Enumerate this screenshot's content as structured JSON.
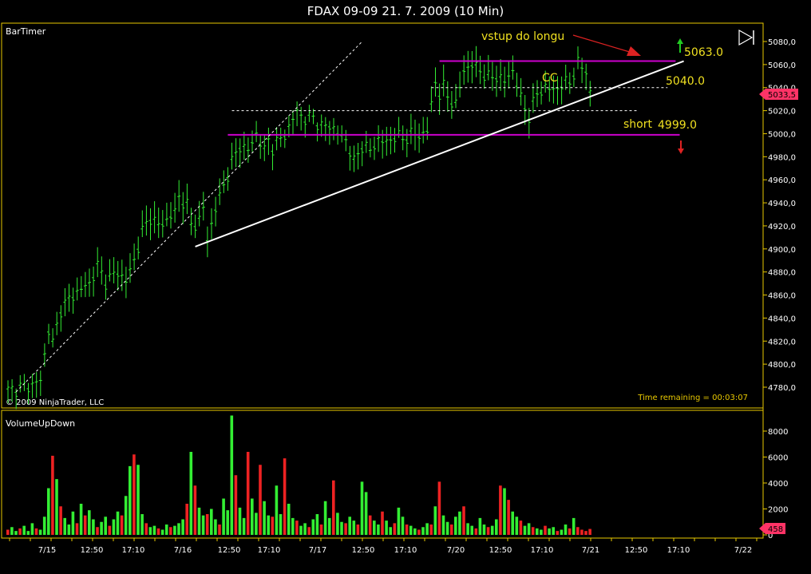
{
  "window": {
    "title": "FDAX 09-09  21. 7. 2009 (10 Min)"
  },
  "price_panel": {
    "indicator_label": "BarTimer",
    "copyright": "© 2009 NinjaTrader, LLC",
    "time_remaining": "Time remaining = 00:03:07",
    "current_price_badge": "5033,5",
    "y_ticks": [
      "5080,0",
      "5060,0",
      "5040,0",
      "5020,0",
      "5000,0",
      "4980,0",
      "4960,0",
      "4940,0",
      "4920,0",
      "4900,0",
      "4880,0",
      "4860,0",
      "4840,0",
      "4820,0",
      "4800,0",
      "4780,0"
    ],
    "annotations": {
      "entry_text": "vstup do longu",
      "cc_text": "CC",
      "short_text": "short",
      "level_high": "5063.0",
      "level_mid": "5040.0",
      "level_low": "4999.0"
    }
  },
  "volume_panel": {
    "label": "VolumeUpDown",
    "y_ticks": [
      "8000",
      "6000",
      "4000",
      "2000",
      "0"
    ],
    "current_volume_badge": "458"
  },
  "x_ticks": [
    "7/15",
    "12:50",
    "17:10",
    "7/16",
    "12:50",
    "17:10",
    "7/17",
    "12:50",
    "17:10",
    "7/20",
    "12:50",
    "17:10",
    "7/21",
    "12:50",
    "17:10",
    "7/22"
  ],
  "colors": {
    "background": "#000000",
    "grid": "#e8c800",
    "price_bars": "#33ee33",
    "volume_up": "#33ee33",
    "volume_down": "#ee2222",
    "resistance_lines": "#cc00cc",
    "trend_lines": "#ffffff",
    "annotation_text": "#f0e020",
    "arrow_up": "#22cc22",
    "arrow_down": "#dd2222",
    "badge": "#ff3366"
  },
  "chart_data": {
    "type": "ohlc",
    "instrument": "FDAX 09-09",
    "interval": "10 Min",
    "price_range": [
      4770,
      5090
    ],
    "volume_range": [
      0,
      9400
    ],
    "price_path": [
      [
        0,
        4777
      ],
      [
        3,
        4780
      ],
      [
        6,
        4782
      ],
      [
        8,
        4786
      ],
      [
        10,
        4830
      ],
      [
        11,
        4818
      ],
      [
        13,
        4848
      ],
      [
        16,
        4860
      ],
      [
        20,
        4870
      ],
      [
        22,
        4885
      ],
      [
        24,
        4872
      ],
      [
        27,
        4880
      ],
      [
        29,
        4872
      ],
      [
        31,
        4890
      ],
      [
        33,
        4915
      ],
      [
        35,
        4928
      ],
      [
        37,
        4920
      ],
      [
        39,
        4925
      ],
      [
        41,
        4932
      ],
      [
        42,
        4945
      ],
      [
        44,
        4938
      ],
      [
        45,
        4920
      ],
      [
        47,
        4925
      ],
      [
        48,
        4935
      ],
      [
        49,
        4908
      ],
      [
        51,
        4935
      ],
      [
        53,
        4955
      ],
      [
        55,
        4975
      ],
      [
        57,
        4990
      ],
      [
        59,
        4985
      ],
      [
        61,
        5000
      ],
      [
        63,
        4985
      ],
      [
        64,
        4995
      ],
      [
        65,
        4988
      ],
      [
        67,
        4995
      ],
      [
        69,
        5005
      ],
      [
        71,
        5020
      ],
      [
        73,
        5012
      ],
      [
        75,
        5015
      ],
      [
        77,
        5005
      ],
      [
        79,
        5008
      ],
      [
        81,
        5000
      ],
      [
        83,
        4995
      ],
      [
        85,
        4975
      ],
      [
        87,
        4990
      ],
      [
        89,
        4985
      ],
      [
        91,
        4995
      ],
      [
        93,
        4992
      ],
      [
        95,
        4998
      ],
      [
        97,
        4995
      ],
      [
        99,
        5000
      ],
      [
        101,
        4998
      ],
      [
        103,
        5003
      ],
      [
        105,
        5045
      ],
      [
        106,
        5035
      ],
      [
        107,
        5040
      ],
      [
        108,
        5032
      ],
      [
        110,
        5025
      ],
      [
        112,
        5055
      ],
      [
        114,
        5060
      ],
      [
        116,
        5055
      ],
      [
        118,
        5048
      ],
      [
        120,
        5050
      ],
      [
        122,
        5045
      ],
      [
        124,
        5055
      ],
      [
        126,
        5030
      ],
      [
        128,
        5015
      ],
      [
        130,
        5035
      ],
      [
        132,
        5040
      ],
      [
        134,
        5038
      ],
      [
        136,
        5042
      ],
      [
        138,
        5045
      ],
      [
        140,
        5060
      ],
      [
        142,
        5055
      ],
      [
        143,
        5035
      ]
    ],
    "volume_bars": [
      [
        0,
        400,
        "down"
      ],
      [
        1,
        600,
        "up"
      ],
      [
        2,
        300,
        "up"
      ],
      [
        3,
        500,
        "down"
      ],
      [
        4,
        700,
        "up"
      ],
      [
        5,
        300,
        "up"
      ],
      [
        6,
        900,
        "up"
      ],
      [
        7,
        500,
        "down"
      ],
      [
        8,
        400,
        "up"
      ],
      [
        9,
        1400,
        "up"
      ],
      [
        10,
        3600,
        "up"
      ],
      [
        11,
        6100,
        "down"
      ],
      [
        12,
        4300,
        "up"
      ],
      [
        13,
        2200,
        "down"
      ],
      [
        14,
        1300,
        "up"
      ],
      [
        15,
        800,
        "up"
      ],
      [
        16,
        1800,
        "up"
      ],
      [
        17,
        900,
        "down"
      ],
      [
        18,
        2400,
        "up"
      ],
      [
        19,
        1500,
        "down"
      ],
      [
        20,
        1900,
        "up"
      ],
      [
        21,
        1200,
        "up"
      ],
      [
        22,
        600,
        "down"
      ],
      [
        23,
        1000,
        "up"
      ],
      [
        24,
        1400,
        "up"
      ],
      [
        25,
        700,
        "down"
      ],
      [
        26,
        1200,
        "up"
      ],
      [
        27,
        1800,
        "up"
      ],
      [
        28,
        1500,
        "down"
      ],
      [
        29,
        3000,
        "up"
      ],
      [
        30,
        5300,
        "up"
      ],
      [
        31,
        6200,
        "down"
      ],
      [
        32,
        5400,
        "up"
      ],
      [
        33,
        1600,
        "up"
      ],
      [
        34,
        900,
        "down"
      ],
      [
        35,
        600,
        "up"
      ],
      [
        36,
        700,
        "up"
      ],
      [
        37,
        500,
        "down"
      ],
      [
        38,
        400,
        "up"
      ],
      [
        39,
        800,
        "up"
      ],
      [
        40,
        600,
        "down"
      ],
      [
        41,
        700,
        "up"
      ],
      [
        42,
        900,
        "up"
      ],
      [
        43,
        1200,
        "up"
      ],
      [
        44,
        2400,
        "down"
      ],
      [
        45,
        6400,
        "up"
      ],
      [
        46,
        3800,
        "down"
      ],
      [
        47,
        2100,
        "up"
      ],
      [
        48,
        1500,
        "up"
      ],
      [
        49,
        1600,
        "down"
      ],
      [
        50,
        2000,
        "up"
      ],
      [
        51,
        1200,
        "up"
      ],
      [
        52,
        800,
        "down"
      ],
      [
        53,
        2800,
        "up"
      ],
      [
        54,
        1900,
        "up"
      ],
      [
        55,
        9200,
        "up"
      ],
      [
        56,
        4600,
        "down"
      ],
      [
        57,
        2100,
        "up"
      ],
      [
        58,
        1300,
        "up"
      ],
      [
        59,
        6400,
        "down"
      ],
      [
        60,
        2800,
        "up"
      ],
      [
        61,
        1700,
        "up"
      ],
      [
        62,
        5400,
        "down"
      ],
      [
        63,
        2600,
        "up"
      ],
      [
        64,
        1500,
        "up"
      ],
      [
        65,
        1400,
        "down"
      ],
      [
        66,
        3800,
        "up"
      ],
      [
        67,
        1600,
        "up"
      ],
      [
        68,
        5900,
        "down"
      ],
      [
        69,
        2400,
        "up"
      ],
      [
        70,
        1300,
        "up"
      ],
      [
        71,
        1100,
        "down"
      ],
      [
        72,
        700,
        "up"
      ],
      [
        73,
        900,
        "up"
      ],
      [
        74,
        600,
        "down"
      ],
      [
        75,
        1200,
        "up"
      ],
      [
        76,
        1600,
        "up"
      ],
      [
        77,
        800,
        "down"
      ],
      [
        78,
        2600,
        "up"
      ],
      [
        79,
        1300,
        "up"
      ],
      [
        80,
        4200,
        "down"
      ],
      [
        81,
        1700,
        "up"
      ],
      [
        82,
        1000,
        "up"
      ],
      [
        83,
        900,
        "down"
      ],
      [
        84,
        1400,
        "up"
      ],
      [
        85,
        1100,
        "up"
      ],
      [
        86,
        800,
        "down"
      ],
      [
        87,
        4100,
        "up"
      ],
      [
        88,
        3300,
        "up"
      ],
      [
        89,
        1500,
        "down"
      ],
      [
        90,
        1100,
        "up"
      ],
      [
        91,
        800,
        "up"
      ],
      [
        92,
        1800,
        "down"
      ],
      [
        93,
        1100,
        "up"
      ],
      [
        94,
        600,
        "up"
      ],
      [
        95,
        900,
        "down"
      ],
      [
        96,
        2100,
        "up"
      ],
      [
        97,
        1400,
        "up"
      ],
      [
        98,
        800,
        "down"
      ],
      [
        99,
        700,
        "up"
      ],
      [
        100,
        500,
        "up"
      ],
      [
        101,
        400,
        "down"
      ],
      [
        102,
        600,
        "up"
      ],
      [
        103,
        900,
        "up"
      ],
      [
        104,
        800,
        "down"
      ],
      [
        105,
        2200,
        "up"
      ],
      [
        106,
        4100,
        "down"
      ],
      [
        107,
        1500,
        "up"
      ],
      [
        108,
        1000,
        "up"
      ],
      [
        109,
        800,
        "down"
      ],
      [
        110,
        1400,
        "up"
      ],
      [
        111,
        1800,
        "up"
      ],
      [
        112,
        2200,
        "down"
      ],
      [
        113,
        900,
        "up"
      ],
      [
        114,
        700,
        "up"
      ],
      [
        115,
        500,
        "down"
      ],
      [
        116,
        1300,
        "up"
      ],
      [
        117,
        800,
        "up"
      ],
      [
        118,
        600,
        "down"
      ],
      [
        119,
        700,
        "up"
      ],
      [
        120,
        1200,
        "up"
      ],
      [
        121,
        3800,
        "down"
      ],
      [
        122,
        3600,
        "up"
      ],
      [
        123,
        2700,
        "down"
      ],
      [
        124,
        1800,
        "up"
      ],
      [
        125,
        1400,
        "up"
      ],
      [
        126,
        1100,
        "down"
      ],
      [
        127,
        700,
        "up"
      ],
      [
        128,
        900,
        "up"
      ],
      [
        129,
        600,
        "down"
      ],
      [
        130,
        500,
        "up"
      ],
      [
        131,
        400,
        "up"
      ],
      [
        132,
        700,
        "down"
      ],
      [
        133,
        500,
        "up"
      ],
      [
        134,
        600,
        "up"
      ],
      [
        135,
        300,
        "down"
      ],
      [
        136,
        400,
        "up"
      ],
      [
        137,
        800,
        "up"
      ],
      [
        138,
        500,
        "down"
      ],
      [
        139,
        1300,
        "up"
      ],
      [
        140,
        600,
        "down"
      ],
      [
        141,
        400,
        "down"
      ],
      [
        142,
        300,
        "down"
      ],
      [
        143,
        458,
        "down"
      ]
    ],
    "horizontal_lines": [
      {
        "price": 5063,
        "style": "solid",
        "color": "magenta",
        "from_bar": 106,
        "to_bar": 164
      },
      {
        "price": 5040,
        "style": "dashed",
        "color": "white",
        "from_bar": 104,
        "to_bar": 162
      },
      {
        "price": 5020,
        "style": "dashed",
        "color": "white",
        "from_bar": 55,
        "to_bar": 155
      },
      {
        "price": 4999,
        "style": "solid",
        "color": "magenta",
        "from_bar": 54,
        "to_bar": 165
      }
    ],
    "trend_lines": [
      {
        "from": [
          46,
          4902
        ],
        "to": [
          166,
          5063
        ],
        "style": "solid",
        "color": "white"
      },
      {
        "from": [
          2,
          4776
        ],
        "to": [
          87,
          5080
        ],
        "style": "dashed",
        "color": "white"
      }
    ],
    "bar_count": 144
  }
}
